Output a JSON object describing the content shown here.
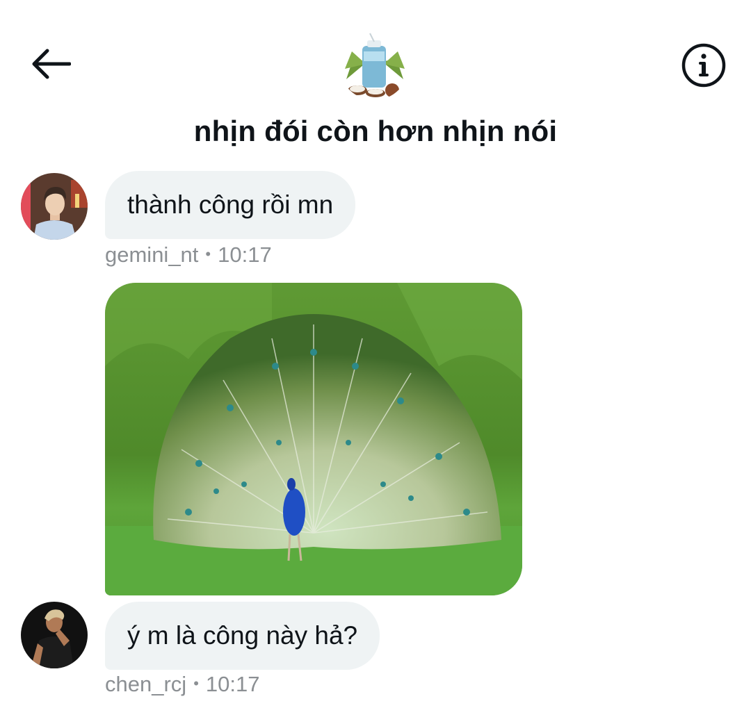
{
  "header": {
    "back_icon": "back-arrow-icon",
    "info_icon": "info-icon",
    "group_avatar_icon": "coconut-drink-avatar",
    "title": "nhịn đói còn hơn nhịn nói"
  },
  "messages": [
    {
      "type": "text",
      "avatar_icon": "user-avatar-gemini",
      "text": "thành công rồi mn",
      "sender": "gemini_nt",
      "separator": "•",
      "time": "10:17"
    },
    {
      "type": "image",
      "image_icon": "peacock-photo"
    },
    {
      "type": "text",
      "avatar_icon": "user-avatar-chen",
      "text": "ý m là công này hả?",
      "sender": "chen_rcj",
      "separator": "•",
      "time": "10:17"
    }
  ],
  "colors": {
    "bubble_bg": "#eff3f4",
    "text": "#0f1419",
    "meta": "#8b8f93"
  }
}
